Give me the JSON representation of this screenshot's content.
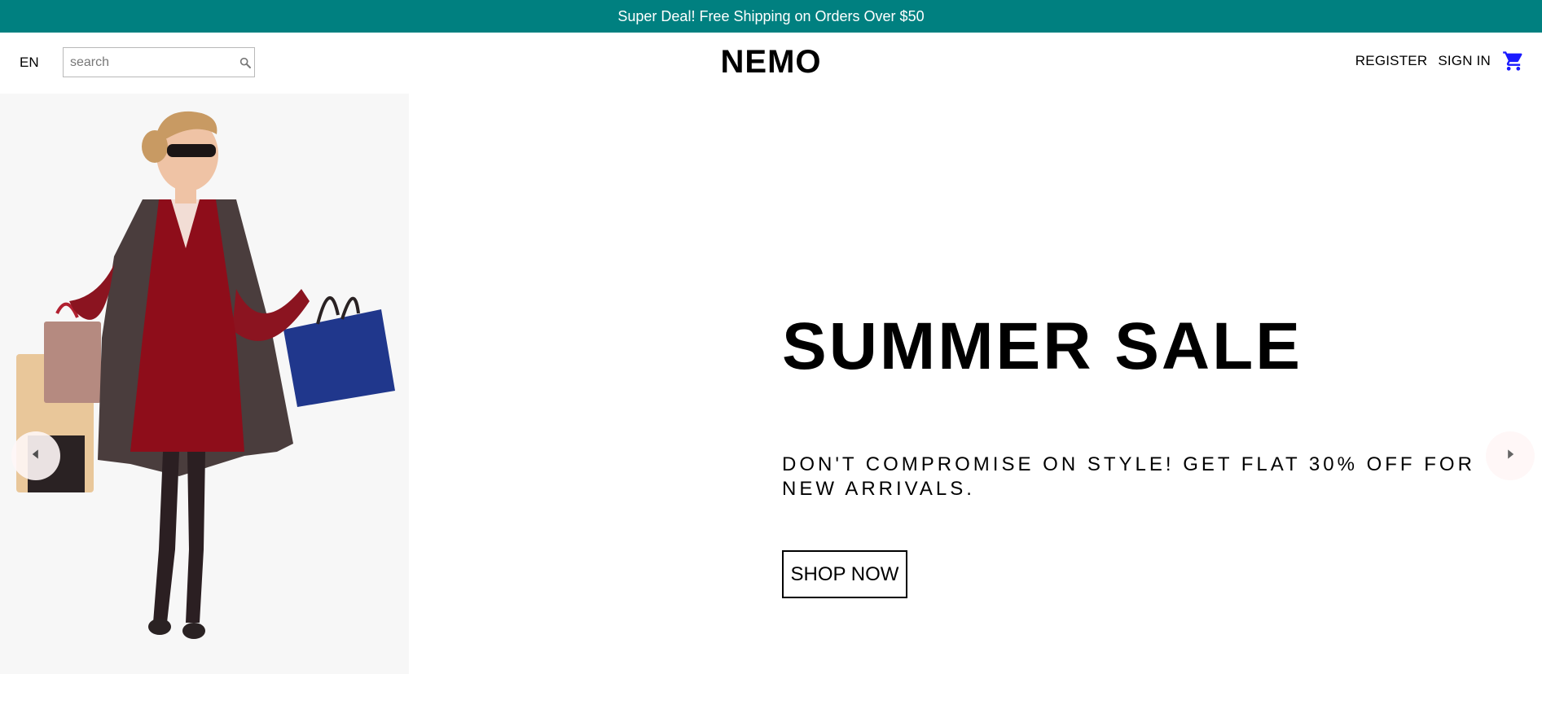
{
  "announcement": {
    "text": "Super Deal! Free Shipping on Orders Over $50"
  },
  "navbar": {
    "language": "EN",
    "search_placeholder": "search",
    "logo": "NEMO",
    "register": "REGISTER",
    "sign_in": "SIGN IN",
    "icons": {
      "search": "search-icon",
      "cart": "shopping-cart-icon"
    }
  },
  "hero": {
    "title": "SUMMER SALE",
    "description": "DON'T COMPROMISE ON STYLE! GET FLAT 30% OFF FOR NEW ARRIVALS.",
    "cta": "SHOP NOW",
    "prev_icon": "arrow-left-icon",
    "next_icon": "arrow-right-icon"
  },
  "colors": {
    "announcement_bg": "#008080",
    "cart_icon": "#1a1aff",
    "image_panel_bg": "#f7f7f7"
  }
}
